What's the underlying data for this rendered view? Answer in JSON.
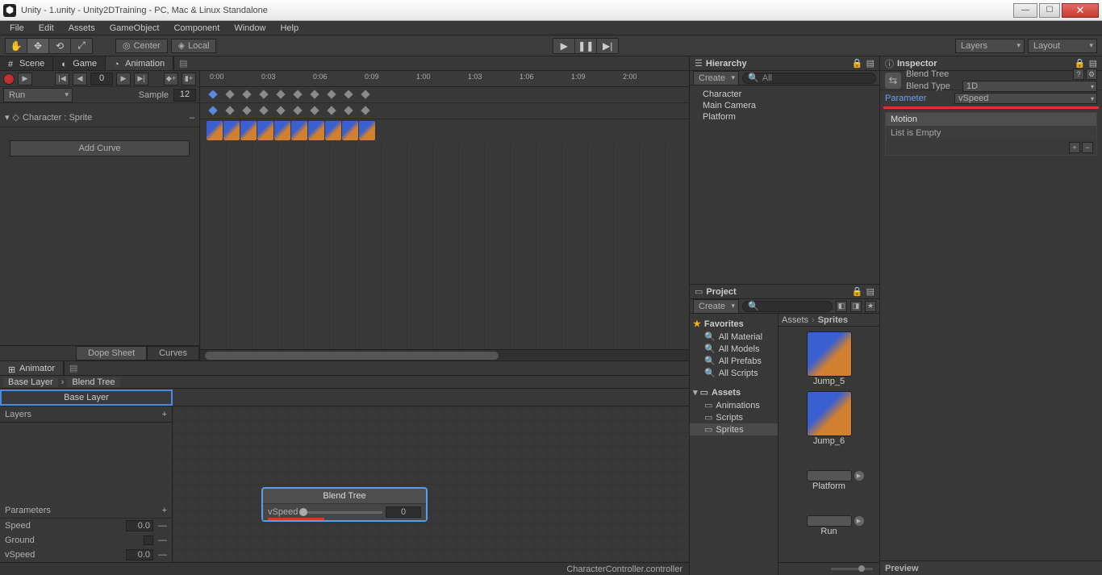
{
  "window": {
    "title": "Unity - 1.unity - Unity2DTraining - PC, Mac & Linux Standalone"
  },
  "menu": [
    "File",
    "Edit",
    "Assets",
    "GameObject",
    "Component",
    "Window",
    "Help"
  ],
  "toolbar": {
    "pivot": "Center",
    "handle": "Local",
    "layers": "Layers",
    "layout": "Layout"
  },
  "tabs_top": {
    "scene": "Scene",
    "game": "Game",
    "animation": "Animation"
  },
  "animation": {
    "frame": "0",
    "clip": "Run",
    "sample_label": "Sample",
    "sample_value": "12",
    "track": "Character : Sprite",
    "add_curve": "Add Curve",
    "dope": "Dope Sheet",
    "curves": "Curves",
    "ticks": [
      "0:00",
      "0:03",
      "0:06",
      "0:09",
      "1:00",
      "1:03",
      "1:06",
      "1:09",
      "2:00"
    ]
  },
  "animator": {
    "tab": "Animator",
    "base_layer": "Base Layer",
    "blend_tree": "Blend Tree",
    "layer_button": "Base Layer",
    "layers_label": "Layers",
    "parameters_label": "Parameters",
    "params": [
      {
        "name": "Speed",
        "value": "0.0",
        "type": "float"
      },
      {
        "name": "Ground",
        "type": "bool"
      },
      {
        "name": "vSpeed",
        "value": "0.0",
        "type": "float"
      }
    ],
    "node": {
      "title": "Blend Tree",
      "param": "vSpeed",
      "value": "0"
    },
    "status": "CharacterController.controller"
  },
  "hierarchy": {
    "title": "Hierarchy",
    "create": "Create",
    "search": "All",
    "items": [
      "Character",
      "Main Camera",
      "Platform"
    ]
  },
  "project": {
    "title": "Project",
    "create": "Create",
    "favorites": "Favorites",
    "fav_items": [
      "All Material",
      "All Models",
      "All Prefabs",
      "All Scripts"
    ],
    "assets": "Assets",
    "folders": [
      "Animations",
      "Scripts",
      "Sprites"
    ],
    "path": [
      "Assets",
      "Sprites"
    ],
    "thumbs": [
      "Jump_5",
      "Jump_6",
      "Platform",
      "Run"
    ]
  },
  "inspector": {
    "title": "Inspector",
    "name": "Blend Tree",
    "blend_type_label": "Blend Type",
    "blend_type_value": "1D",
    "parameter_label": "Parameter",
    "parameter_value": "vSpeed",
    "motion": "Motion",
    "list_empty": "List is Empty",
    "preview": "Preview"
  }
}
